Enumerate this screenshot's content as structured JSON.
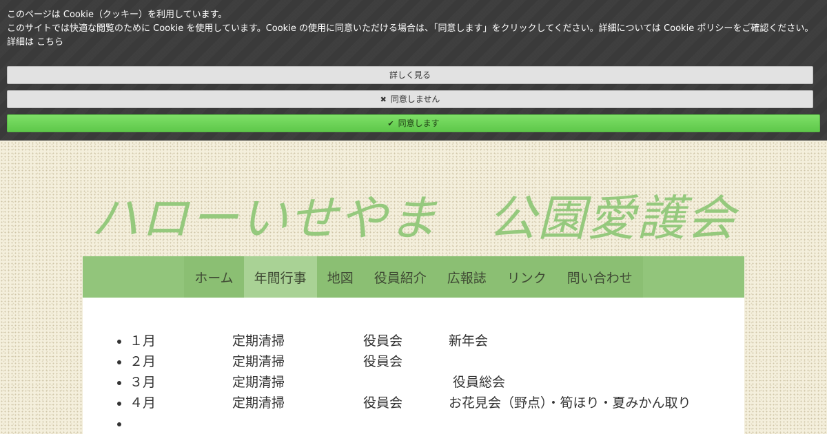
{
  "cookie": {
    "heading": "このページは Cookie（クッキー）を利用しています。",
    "message": "このサイトでは快適な閲覧のために Cookie を使用しています。Cookie の使用に同意いただける場合は、「同意します」をクリックしてください。詳細については Cookie ポリシーをご確認ください。",
    "details_prefix": "詳細は",
    "details_link": "こちら",
    "btn_more": "詳しく見る",
    "btn_decline": "同意しません",
    "btn_accept": "同意します",
    "icon_decline": "close-icon",
    "icon_accept": "check-icon"
  },
  "site": {
    "title": "ハローいせやま　公園愛護会"
  },
  "nav": {
    "items": [
      "ホーム",
      "年間行事",
      "地図",
      "役員紹介",
      "広報誌",
      "リンク",
      "問い合わせ"
    ],
    "active": "年間行事"
  },
  "schedule": [
    {
      "month": "１月",
      "a": "定期清掃",
      "b": "役員会",
      "c": "新年会"
    },
    {
      "month": "２月",
      "a": "定期清掃",
      "b": "役員会",
      "c": ""
    },
    {
      "month": "３月",
      "a": "定期清掃",
      "b": "",
      "c": "役員総会"
    },
    {
      "month": "４月",
      "a": "定期清掃",
      "b": "役員会",
      "c": "お花見会（野点）・筍ほり・夏みかん取り"
    },
    {
      "month": "",
      "a": "",
      "b": "",
      "c": ""
    }
  ],
  "colors": {
    "banner_bg": "#3a3a3a",
    "accept_green": "#6fd55a",
    "title_green": "#95c97d",
    "nav_green": "#92c57b",
    "nav_active": "#a9d295"
  }
}
